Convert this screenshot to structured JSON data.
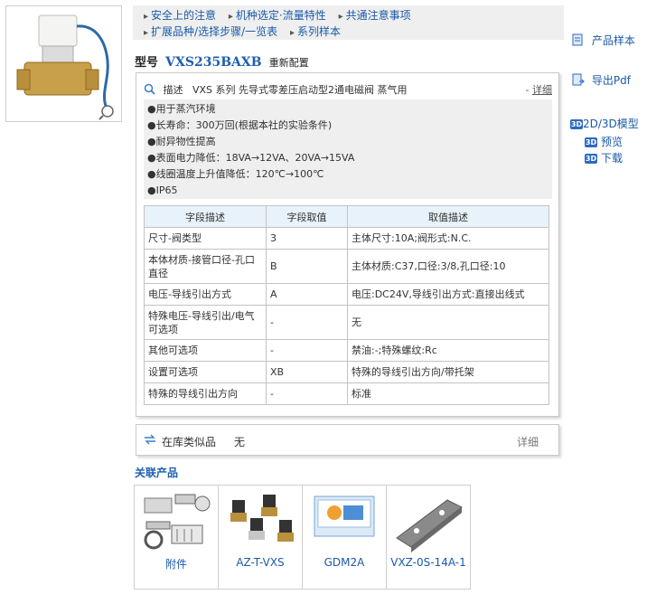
{
  "top_links": {
    "row1": [
      "安全上的注意",
      "机种选定·流量特性",
      "共通注意事项"
    ],
    "row2": [
      "扩展品种/选择步骤/一览表",
      "系列样本"
    ]
  },
  "model": {
    "label": "型号",
    "code": "VXS235BAXB",
    "reconfigure": "重新配置"
  },
  "description": {
    "label": "描述",
    "text": "VXS 系列 先导式零差压启动型2通电磁阀 蒸气用",
    "more": "详细",
    "more_prefix": "-"
  },
  "features": [
    "●用于蒸汽环境",
    "●长寿命：300万回(根据本社的实验条件)",
    "●耐异物性提高",
    "●表面电力降低：18VA→12VA、20VA→15VA",
    "●线圈温度上升值降低：120℃→100℃",
    "●IP65"
  ],
  "table": {
    "headers": [
      "字段描述",
      "字段取值",
      "取值描述"
    ],
    "rows": [
      [
        "尺寸-阀类型",
        "3",
        "主体尺寸:10A;阀形式:N.C."
      ],
      [
        "本体材质-接管口径-孔口直径",
        "B",
        "主体材质:C37,口径:3/8,孔口径:10"
      ],
      [
        "电压-导线引出方式",
        "A",
        "电压:DC24V,导线引出方式:直接出线式"
      ],
      [
        "特殊电压-导线引出/电气可选项",
        "-",
        "无"
      ],
      [
        "其他可选项",
        "-",
        "禁油:-;特殊螺纹:Rc"
      ],
      [
        "设置可选项",
        "XB",
        "特殊的导线引出方向/带托架"
      ],
      [
        "特殊的导线引出方向",
        "-",
        "标准"
      ]
    ]
  },
  "stock": {
    "label": "在库类似品",
    "value": "无",
    "more": "详细"
  },
  "related": {
    "title": "关联产品",
    "items": [
      "附件",
      "AZ-T-VXS",
      "GDM2A",
      "VXZ-0S-14A-1"
    ]
  },
  "sidebar": {
    "catalog": "产品样本",
    "export_pdf": "导出Pdf",
    "model_2d3d": "2D/3D模型",
    "badge": "3D",
    "preview": "预览",
    "download": "下载"
  },
  "colors": {
    "link": "#1a5aa8",
    "model_code": "#1d5fb0",
    "table_header_bg": "#e8f2fb",
    "panel_bg": "#efefef"
  }
}
